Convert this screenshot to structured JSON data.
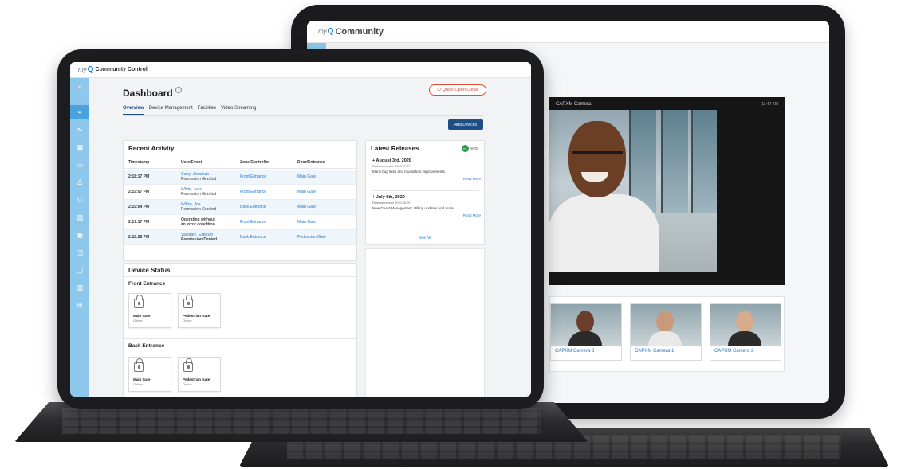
{
  "back_app": {
    "brand_my": "my",
    "brand_q": "Q",
    "title": "Community",
    "camera": {
      "title": "CAPXM Camera",
      "time": "11:47 AM"
    },
    "thumbnails": [
      {
        "label": "CAPXM Camera 3"
      },
      {
        "label": "CAPXM Camera 1"
      },
      {
        "label": "CAPXM Camera 2"
      }
    ]
  },
  "front_app": {
    "brand_my": "my",
    "brand_q": "Q",
    "title": "Community Control",
    "page_title": "Dashboard",
    "help_icon": "?",
    "quick_button": "Quick Open/Close",
    "tabs": [
      {
        "label": "Overview",
        "active": true
      },
      {
        "label": "Device Management"
      },
      {
        "label": "Facilities"
      },
      {
        "label": "Video Streaming"
      }
    ],
    "add_devices": "Add Devices",
    "recent_activity": {
      "title": "Recent Activity",
      "columns": [
        "Timestamp",
        "User/Event",
        "Zone/Controller",
        "Door/Entrance"
      ],
      "rows": [
        {
          "time": "2:18:17 PM",
          "name": "Curry, Jonathan",
          "event": "Permission Granted",
          "zone": "Front Entrance",
          "door": "Main Gate"
        },
        {
          "time": "2:19:07 PM",
          "name": "White, Jess",
          "event": "Permission Granted",
          "zone": "Front Entrance",
          "door": "Main Gate"
        },
        {
          "time": "2:19:04 PM",
          "name": "Wil ke, Joe",
          "event": "Permission Granted",
          "zone": "Back Entrance",
          "door": "Main Gate"
        },
        {
          "time": "2:17:17 PM",
          "name": "Operating without",
          "event": "an error condition",
          "zone": "Front Entrance",
          "door": "Main Gate"
        },
        {
          "time": "2:18:28 PM",
          "name": "Vasquez, Esteban",
          "event": "Permission Denied.",
          "zone": "Back Entrance",
          "door": "Pedestrian Gate"
        }
      ]
    },
    "device_status": {
      "title": "Device Status",
      "groups": [
        {
          "title": "Front Entrance",
          "doors": [
            {
              "name": "Main Gate",
              "status": "Online"
            },
            {
              "name": "Pedestrian Gate",
              "status": "Online"
            }
          ]
        },
        {
          "title": "Back Entrance",
          "doors": [
            {
              "name": "Main Gate",
              "status": "Online"
            },
            {
              "name": "Pedestrian Gate",
              "status": "Online"
            }
          ]
        }
      ]
    },
    "releases": {
      "title": "Latest Releases",
      "logo_text": "myQ",
      "logo_mark": "m",
      "items": [
        {
          "date": "August 3rd, 2020",
          "version": "Release version 2020.07.27",
          "text": "Many bug fixes and foundation improvements.",
          "more": "Read More"
        },
        {
          "date": "July 8th, 2020",
          "version": "Release version 2020.06.29",
          "text": "New Guest Management, Billing updates and more!",
          "more": "Read More"
        }
      ],
      "see_all": "See All"
    },
    "sidebar_icons": [
      "menu-icon",
      "activity-icon",
      "pulse-icon",
      "building-icon",
      "card-icon",
      "user-icon",
      "users-icon",
      "calendar-icon",
      "device-icon",
      "chat-icon",
      "id-card-icon",
      "chart-icon",
      "org-chart-icon"
    ]
  }
}
